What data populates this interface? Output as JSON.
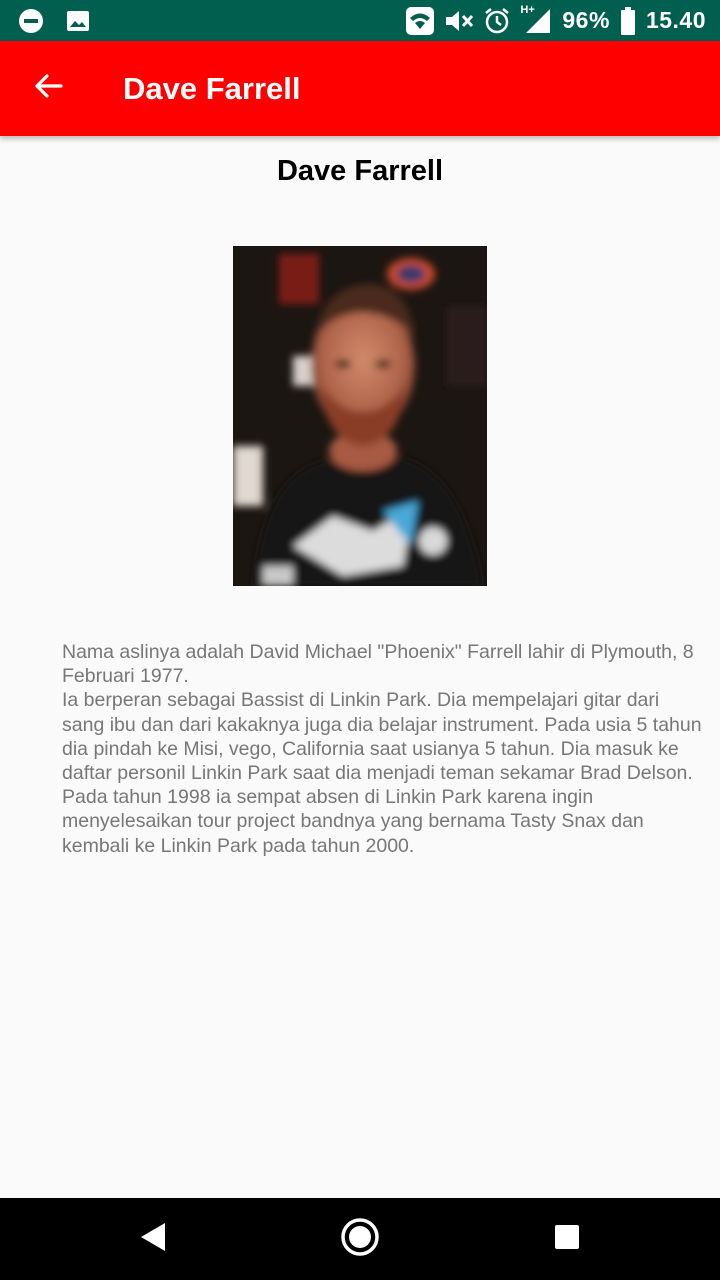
{
  "status_bar": {
    "battery_text": "96%",
    "time": "15.40",
    "network_label": "H+",
    "icons": [
      "minus-circle-icon",
      "image-icon",
      "wifi-icon",
      "volume-mute-icon",
      "alarm-icon",
      "signal-icon",
      "battery-icon"
    ]
  },
  "app_bar": {
    "title": "Dave Farrell",
    "back_icon": "arrow-left-icon",
    "color": "#ff0000"
  },
  "content": {
    "heading": "Dave Farrell",
    "photo_alt": "Dave Farrell",
    "bio_paragraphs": [
      "Nama aslinya adalah David Michael \"Phoenix\" Farrell lahir di Plymouth, 8 Februari 1977.",
      "Ia berperan sebagai Bassist di Linkin Park. Dia mempelajari gitar dari sang ibu dan dari kakaknya juga dia belajar instrument. Pada usia 5 tahun dia pindah ke Misi, vego, California saat usianya 5 tahun. Dia masuk ke daftar personil Linkin Park saat dia menjadi teman sekamar Brad Delson.",
      "Pada tahun 1998 ia sempat absen di Linkin Park karena ingin menyelesaikan tour project bandnya yang bernama Tasty Snax dan kembali  ke Linkin Park pada tahun 2000."
    ]
  },
  "nav_bar": {
    "buttons": [
      "back-triangle-icon",
      "home-circle-icon",
      "recents-square-icon"
    ]
  }
}
